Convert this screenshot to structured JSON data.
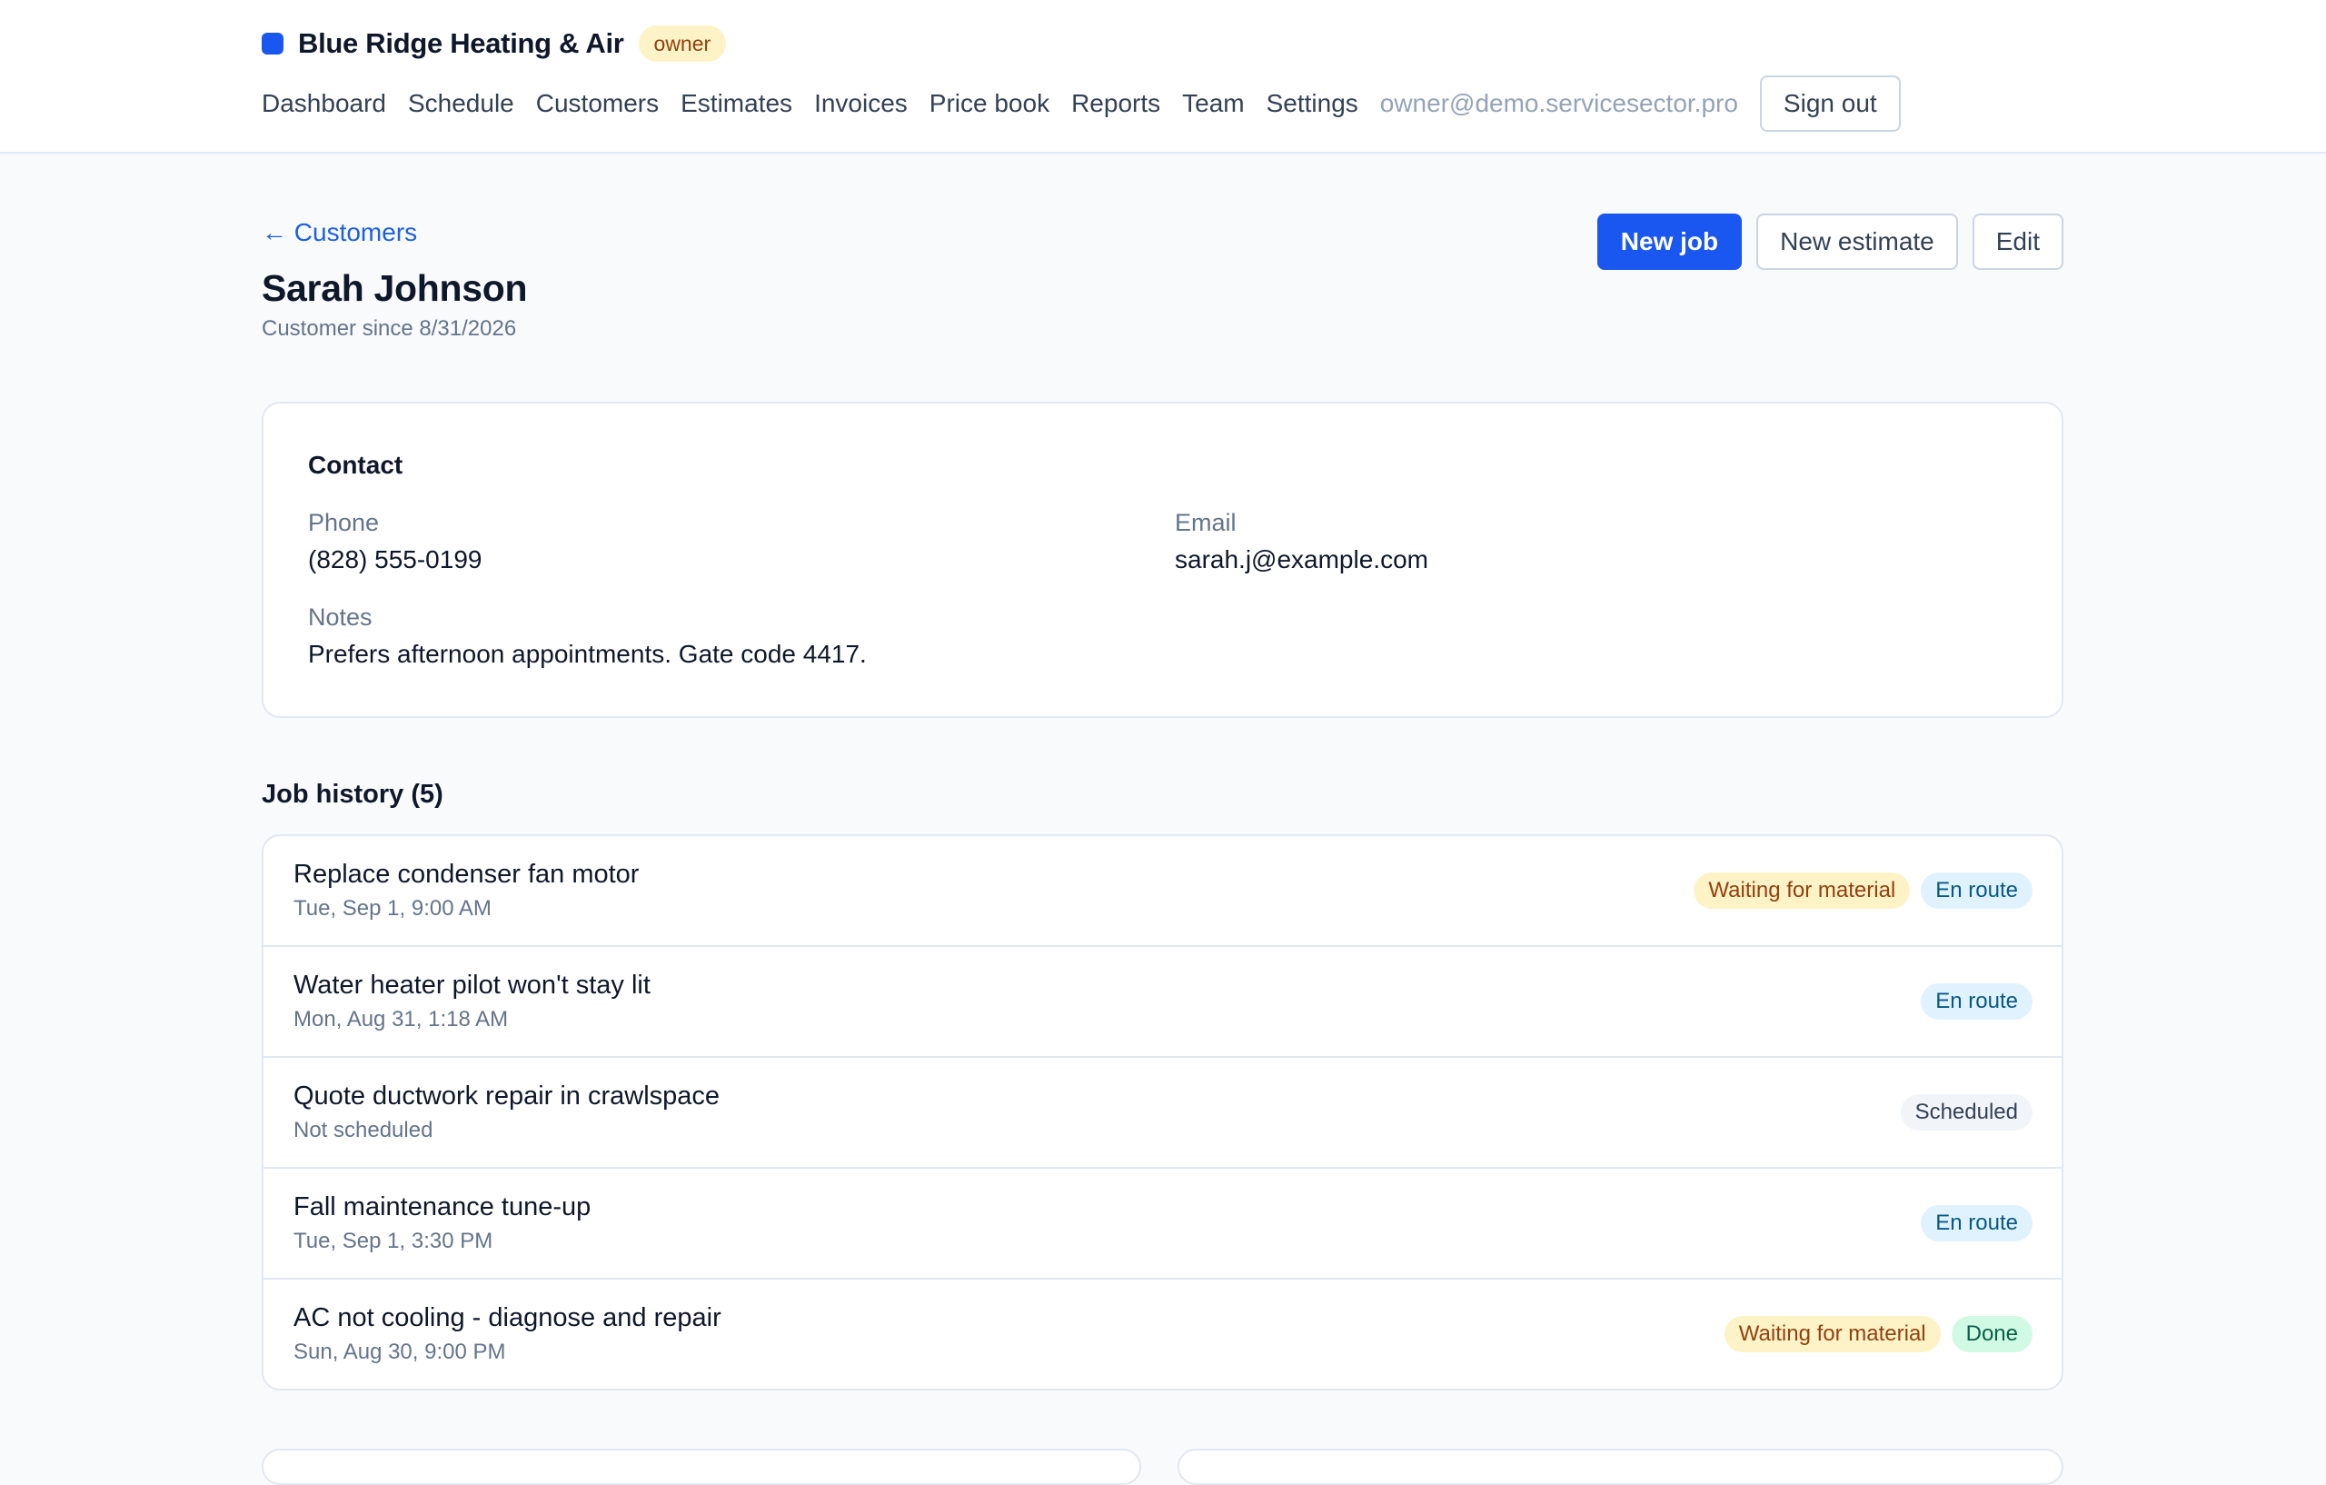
{
  "header": {
    "brand_name": "Blue Ridge Heating & Air",
    "role": "owner",
    "nav": [
      "Dashboard",
      "Schedule",
      "Customers",
      "Estimates",
      "Invoices",
      "Price book",
      "Reports",
      "Team",
      "Settings"
    ],
    "user_email": "owner@demo.servicesector.pro",
    "sign_out_label": "Sign out"
  },
  "page": {
    "back_label": "← Customers",
    "title": "Sarah Johnson",
    "subtitle": "Customer since 8/31/2026",
    "actions": {
      "new_job": "New job",
      "new_estimate": "New estimate",
      "edit": "Edit"
    }
  },
  "contact": {
    "title": "Contact",
    "phone_label": "Phone",
    "phone": "(828) 555-0199",
    "email_label": "Email",
    "email": "sarah.j@example.com",
    "notes_label": "Notes",
    "notes": "Prefers afternoon appointments. Gate code 4417."
  },
  "jobs": {
    "title": "Job history (5)",
    "items": [
      {
        "title": "Replace condenser fan motor",
        "time": "Tue, Sep 1, 9:00 AM",
        "badges": [
          {
            "label": "Waiting for material",
            "kind": "waiting"
          },
          {
            "label": "En route",
            "kind": "enroute"
          }
        ]
      },
      {
        "title": "Water heater pilot won't stay lit",
        "time": "Mon, Aug 31, 1:18 AM",
        "badges": [
          {
            "label": "En route",
            "kind": "enroute"
          }
        ]
      },
      {
        "title": "Quote ductwork repair in crawlspace",
        "time": "Not scheduled",
        "badges": [
          {
            "label": "Scheduled",
            "kind": "scheduled"
          }
        ]
      },
      {
        "title": "Fall maintenance tune-up",
        "time": "Tue, Sep 1, 3:30 PM",
        "badges": [
          {
            "label": "En route",
            "kind": "enroute"
          }
        ]
      },
      {
        "title": "AC not cooling - diagnose and repair",
        "time": "Sun, Aug 30, 9:00 PM",
        "badges": [
          {
            "label": "Waiting for material",
            "kind": "waiting"
          },
          {
            "label": "Done",
            "kind": "done"
          }
        ]
      }
    ]
  },
  "colors": {
    "accent": "#1a56f0",
    "page_background": "#f8fafc"
  }
}
